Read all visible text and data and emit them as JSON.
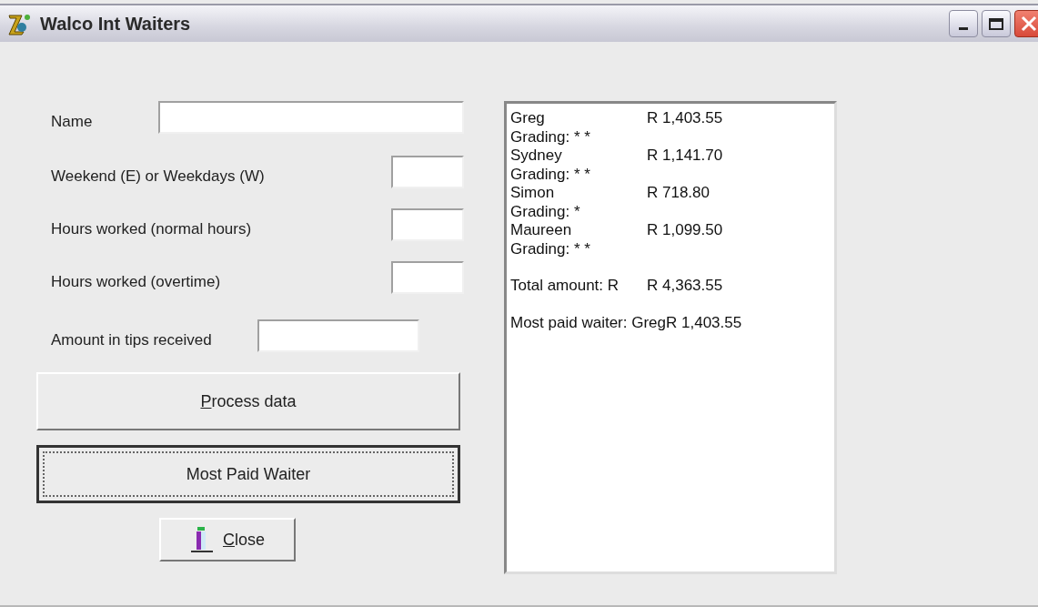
{
  "window": {
    "title": "Walco Int Waiters"
  },
  "fields": [
    {
      "label": "Name",
      "kind": "wide"
    },
    {
      "label": "Weekend (E) or Weekdays (W)",
      "kind": "short"
    },
    {
      "label": "Hours worked (normal hours)",
      "kind": "short"
    },
    {
      "label": "Hours worked (overtime)",
      "kind": "short"
    },
    {
      "label": "Amount in tips received",
      "kind": "medium"
    }
  ],
  "buttons": [
    {
      "accel": "P",
      "rest": "rocess data",
      "focused": false
    },
    {
      "rest": "Most Paid Waiter",
      "focused": true
    }
  ],
  "close_button": {
    "accel": "C",
    "rest": "lose"
  },
  "output_lines": [
    {
      "kind": "columns",
      "left": "Greg",
      "right": "R 1,403.55"
    },
    {
      "kind": "text",
      "left": "Grading: * *"
    },
    {
      "kind": "columns",
      "left": "Sydney",
      "right": "R 1,141.70"
    },
    {
      "kind": "text",
      "left": "Grading: * *"
    },
    {
      "kind": "columns",
      "left": "Simon",
      "right": "R 718.80"
    },
    {
      "kind": "text",
      "left": "Grading: *"
    },
    {
      "kind": "columns",
      "left": "Maureen",
      "right": "R 1,099.50"
    },
    {
      "kind": "text",
      "left": "Grading: * *"
    },
    {
      "kind": "blank"
    },
    {
      "kind": "columns",
      "left": "Total amount: R",
      "right": "R 4,363.55"
    },
    {
      "kind": "blank"
    },
    {
      "kind": "inline",
      "left": "Most paid waiter: Greg",
      "right": "R 1,403.55"
    }
  ]
}
